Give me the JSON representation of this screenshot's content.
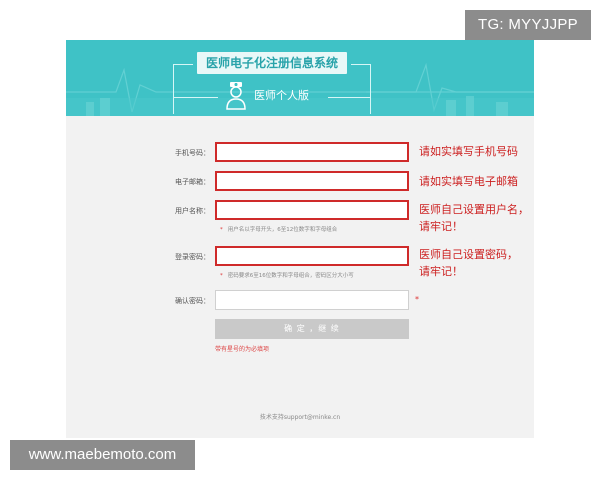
{
  "header": {
    "title": "医师电子化注册信息系统",
    "subtitle": "医师个人版"
  },
  "form": {
    "phone": {
      "label": "手机号码：",
      "value": ""
    },
    "email": {
      "label": "电子邮箱：",
      "value": ""
    },
    "username": {
      "label": "用户名称：",
      "value": "",
      "hint": "用户名以字母开头，6至12位数字和字母组合"
    },
    "password": {
      "label": "登录密码：",
      "value": "",
      "hint": "密码要求6至16位数字和字母组合，密码区分大小写"
    },
    "confirm": {
      "label": "确认密码：",
      "value": ""
    },
    "required_mark": "*",
    "confirm_button": "确 定 ，继 续",
    "login_link": "带有星号的为必填项"
  },
  "annotations": {
    "phone": "请如实填写手机号码",
    "email": "请如实填写电子邮箱",
    "username_line1": "医师自己设置用户名，",
    "username_line2": "请牢记！",
    "password_line1": "医师自己设置密码，",
    "password_line2": "请牢记！"
  },
  "footer": {
    "support": "技术支持support@minke.cn"
  },
  "watermarks": {
    "top": "TG: MYYJJPP",
    "bottom": "www.maebemoto.com"
  },
  "colors": {
    "header": "#3fc2c6",
    "error_border": "#cf2a2a",
    "annotation": "#cc1f1f",
    "button": "#c9c9c9"
  }
}
